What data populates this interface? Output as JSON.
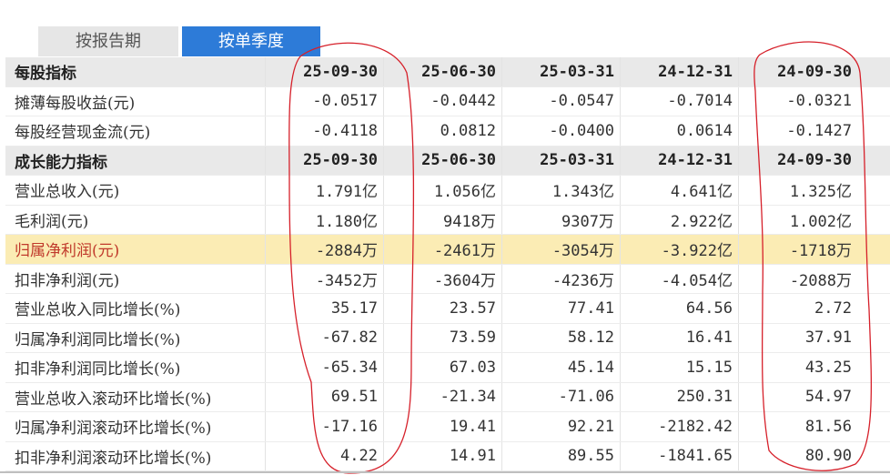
{
  "tabs": [
    {
      "label": "按报告期",
      "active": false
    },
    {
      "label": "按单季度",
      "active": true
    }
  ],
  "table": {
    "sections": [
      {
        "header": {
          "label": "每股指标",
          "dates": [
            "25-09-30",
            "25-06-30",
            "25-03-31",
            "24-12-31",
            "24-09-30"
          ]
        },
        "rows": [
          {
            "label": "摊薄每股收益(元)",
            "values": [
              "-0.0517",
              "-0.0442",
              "-0.0547",
              "-0.7014",
              "-0.0321"
            ],
            "highlight": false
          },
          {
            "label": "每股经营现金流(元)",
            "values": [
              "-0.4118",
              "0.0812",
              "-0.0400",
              "0.0614",
              "-0.1427"
            ],
            "highlight": false
          }
        ]
      },
      {
        "header": {
          "label": "成长能力指标",
          "dates": [
            "25-09-30",
            "25-06-30",
            "25-03-31",
            "24-12-31",
            "24-09-30"
          ]
        },
        "rows": [
          {
            "label": "营业总收入(元)",
            "values": [
              "1.791亿",
              "1.056亿",
              "1.343亿",
              "4.641亿",
              "1.325亿"
            ],
            "highlight": false
          },
          {
            "label": "毛利润(元)",
            "values": [
              "1.180亿",
              "9418万",
              "9307万",
              "2.922亿",
              "1.002亿"
            ],
            "highlight": false
          },
          {
            "label": "归属净利润(元)",
            "values": [
              "-2884万",
              "-2461万",
              "-3054万",
              "-3.922亿",
              "-1718万"
            ],
            "highlight": true
          },
          {
            "label": "扣非净利润(元)",
            "values": [
              "-3452万",
              "-3604万",
              "-4236万",
              "-4.054亿",
              "-2088万"
            ],
            "highlight": false
          },
          {
            "label": "营业总收入同比增长(%)",
            "values": [
              "35.17",
              "23.57",
              "77.41",
              "64.56",
              "2.72"
            ],
            "highlight": false
          },
          {
            "label": "归属净利润同比增长(%)",
            "values": [
              "-67.82",
              "73.59",
              "58.12",
              "16.41",
              "37.91"
            ],
            "highlight": false
          },
          {
            "label": "扣非净利润同比增长(%)",
            "values": [
              "-65.34",
              "67.03",
              "45.14",
              "15.15",
              "43.25"
            ],
            "highlight": false
          },
          {
            "label": "营业总收入滚动环比增长(%)",
            "values": [
              "69.51",
              "-21.34",
              "-71.06",
              "250.31",
              "54.97"
            ],
            "highlight": false
          },
          {
            "label": "归属净利润滚动环比增长(%)",
            "values": [
              "-17.16",
              "19.41",
              "92.21",
              "-2182.42",
              "81.56"
            ],
            "highlight": false
          },
          {
            "label": "扣非净利润滚动环比增长(%)",
            "values": [
              "4.22",
              "14.91",
              "89.55",
              "-1841.65",
              "80.90"
            ],
            "highlight": false
          }
        ]
      }
    ]
  },
  "colors": {
    "tab_active_bg": "#2d7bd8",
    "tab_inactive_bg": "#e6e6e6",
    "section_bg": "#e9e9e9",
    "highlight_row_bg": "#fbecb4",
    "annotation_stroke": "#d6202a"
  }
}
